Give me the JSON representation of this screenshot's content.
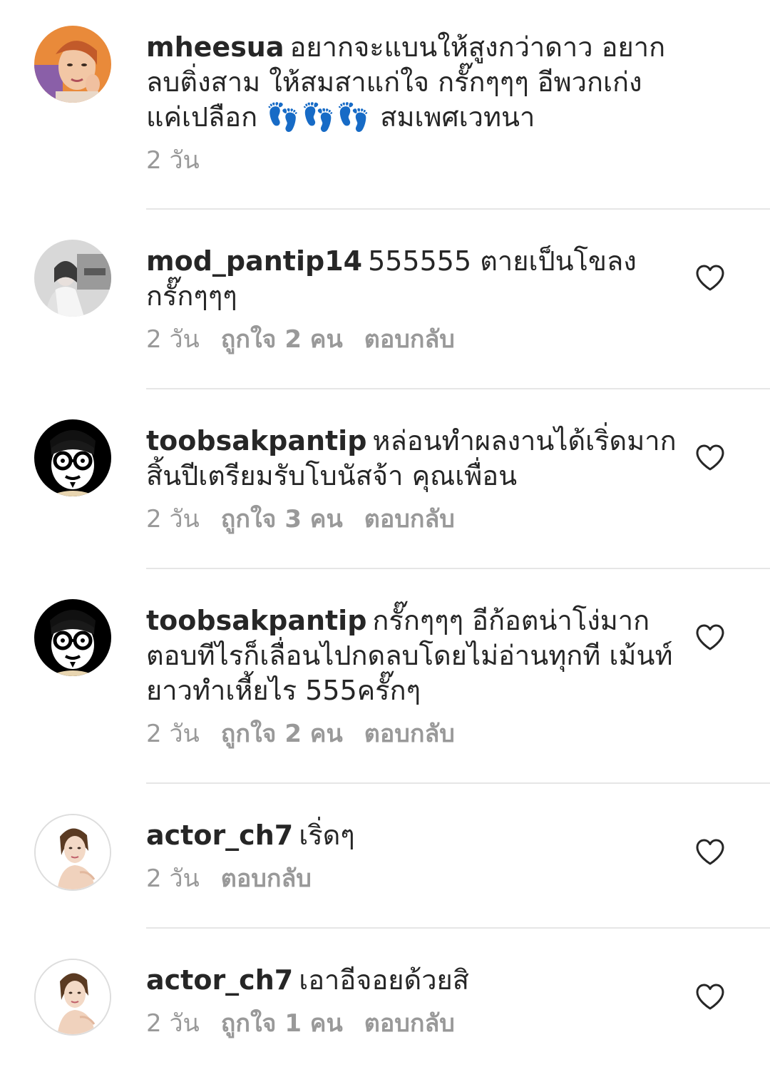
{
  "comments": [
    {
      "username": "mheesua",
      "text_before": "อยากจะแบนให้สูงกว่าดาว อยากลบติ่งสาม ให้สมสาแก่ใจ กรั๊กๆๆๆ อีพวกเก่งแค่เปลือก",
      "emoji": "👣👣👣",
      "text_after": "สมเพศเวทนา",
      "time": "2 วัน",
      "avatar": "avatar-woman-orange",
      "has_heart": false
    },
    {
      "username": "mod_pantip14",
      "text": "555555 ตายเป็นโขลง กรั๊กๆๆๆ",
      "time": "2 วัน",
      "likes": "ถูกใจ 2 คน",
      "reply": "ตอบกลับ",
      "avatar": "avatar-bride-bw",
      "has_heart": true
    },
    {
      "username": "toobsakpantip",
      "text": "หล่อนทำผลงานได้เริ่ดมาก สิ้นปีเตรียมรับโบนัสจ้า คุณเพื่อน",
      "time": "2 วัน",
      "likes": "ถูกใจ 3 คน",
      "reply": "ตอบกลับ",
      "avatar": "avatar-cartoon-glasses",
      "has_heart": true
    },
    {
      "username": "toobsakpantip",
      "text": "กรั๊กๆๆๆ อีก้อตน่าโง่มาก ตอบทีไรก็เลื่อนไปกดลบโดยไม่อ่านทุกที เม้นท์ยาวทำเหี้ยไร 555ครั๊กๆ",
      "time": "2 วัน",
      "likes": "ถูกใจ 2 คน",
      "reply": "ตอบกลับ",
      "avatar": "avatar-cartoon-glasses",
      "has_heart": true
    },
    {
      "username": "actor_ch7",
      "text": "เริ่ดๆ",
      "time": "2 วัน",
      "reply": "ตอบกลับ",
      "avatar": "avatar-actress",
      "has_heart": true
    },
    {
      "username": "actor_ch7",
      "text": "เอาอีจอยด้วยสิ",
      "time": "2 วัน",
      "likes": "ถูกใจ 1 คน",
      "reply": "ตอบกลับ",
      "avatar": "avatar-actress",
      "has_heart": true
    }
  ],
  "colors": {
    "text": "#262626",
    "meta": "#999999",
    "divider": "#e6e6e6",
    "heart_stroke": "#262626"
  }
}
